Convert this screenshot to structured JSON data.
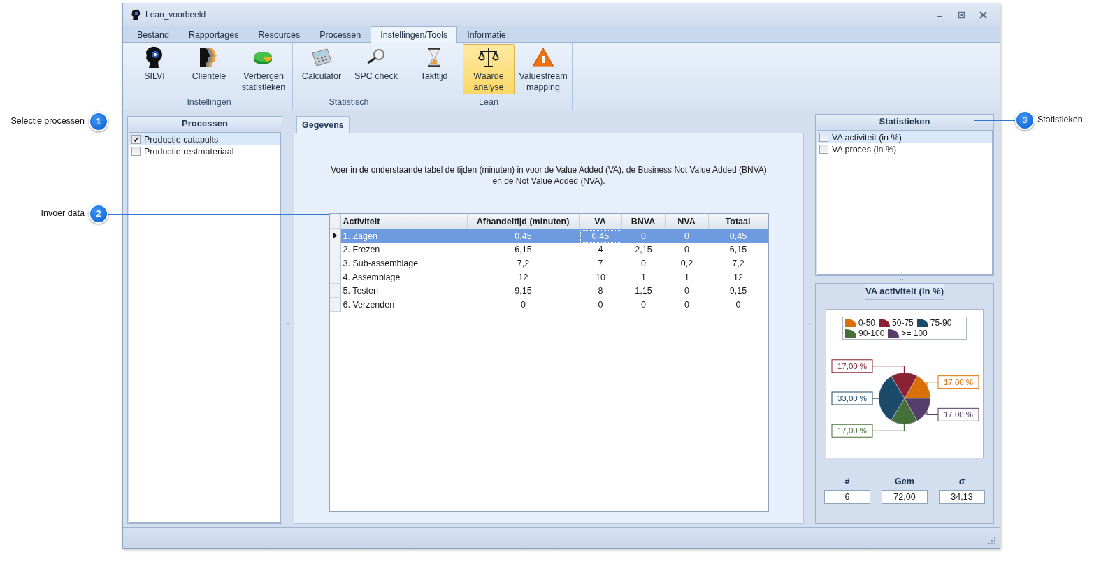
{
  "window": {
    "title": "Lean_voorbeeld"
  },
  "menu_tabs": [
    {
      "label": "Bestand",
      "selected": false
    },
    {
      "label": "Rapportages",
      "selected": false
    },
    {
      "label": "Resources",
      "selected": false
    },
    {
      "label": "Processen",
      "selected": false
    },
    {
      "label": "Instellingen/Tools",
      "selected": true
    },
    {
      "label": "Informatie",
      "selected": false
    }
  ],
  "ribbon_groups": [
    {
      "label": "Instellingen",
      "buttons": [
        {
          "kind": "head",
          "label": "SILVI",
          "selected": false
        },
        {
          "kind": "people",
          "label": "Clientele",
          "selected": false
        },
        {
          "kind": "pie",
          "label": "Verbergen statistieken",
          "selected": false
        }
      ]
    },
    {
      "label": "Statistisch",
      "buttons": [
        {
          "kind": "calculator",
          "label": "Calculator",
          "selected": false
        },
        {
          "kind": "magnifier",
          "label": "SPC check",
          "selected": false
        }
      ]
    },
    {
      "label": "Lean",
      "buttons": [
        {
          "kind": "hourglass",
          "label": "Takttijd",
          "selected": false
        },
        {
          "kind": "scales",
          "label": "Waarde analyse",
          "selected": true
        },
        {
          "kind": "warning",
          "label": "Valuestream mapping",
          "selected": false
        }
      ]
    }
  ],
  "processes_panel": {
    "title": "Processen",
    "items": [
      {
        "label": "Productie catapults",
        "checked": true,
        "selected": true
      },
      {
        "label": "Productie restmateriaal",
        "checked": false,
        "selected": false
      }
    ]
  },
  "data_tab": {
    "label": "Gegevens",
    "selected": true
  },
  "instruction": "Voer in de onderstaande tabel de tijden (minuten) in voor de Value Added (VA), de Business Not Value Added (BNVA) en de Not Value Added (NVA).",
  "table": {
    "columns": [
      "Activiteit",
      "Afhandeltijd (minuten)",
      "VA",
      "BNVA",
      "NVA",
      "Totaal"
    ],
    "rows": [
      {
        "selected": true,
        "focused": [
          false,
          false,
          true,
          false,
          false,
          false
        ],
        "cells": [
          "1. Zagen",
          "0,45",
          "0,45",
          "0",
          "0",
          "0,45"
        ]
      },
      {
        "selected": false,
        "focused": [
          false,
          false,
          false,
          false,
          false,
          false
        ],
        "cells": [
          "2. Frezen",
          "6,15",
          "4",
          "2,15",
          "0",
          "6,15"
        ]
      },
      {
        "selected": false,
        "focused": [
          false,
          false,
          false,
          false,
          false,
          false
        ],
        "cells": [
          "3. Sub-assemblage",
          "7,2",
          "7",
          "0",
          "0,2",
          "7,2"
        ]
      },
      {
        "selected": false,
        "focused": [
          false,
          false,
          false,
          false,
          false,
          false
        ],
        "cells": [
          "4. Assemblage",
          "12",
          "10",
          "1",
          "1",
          "12"
        ]
      },
      {
        "selected": false,
        "focused": [
          false,
          false,
          false,
          false,
          false,
          false
        ],
        "cells": [
          "5. Testen",
          "9,15",
          "8",
          "1,15",
          "0",
          "9,15"
        ]
      },
      {
        "selected": false,
        "focused": [
          false,
          false,
          false,
          false,
          false,
          false
        ],
        "cells": [
          "6. Verzenden",
          "0",
          "0",
          "0",
          "0",
          "0"
        ]
      }
    ]
  },
  "statistics_panel": {
    "title": "Statistieken",
    "items": [
      {
        "label": "VA activiteit (in %)",
        "checked": false,
        "selected": true
      },
      {
        "label": "VA proces (in %)",
        "checked": false,
        "selected": false
      }
    ]
  },
  "chart_panel": {
    "title": "VA activiteit (in %)",
    "chart_data": {
      "type": "pie",
      "categories": [
        "0-50",
        "50-75",
        "75-90",
        "90-100",
        ">= 100"
      ],
      "colors": [
        "#d9700a",
        "#8a2233",
        "#1b4a6b",
        "#45703a",
        "#553d6a"
      ],
      "legend": "top",
      "values": [
        17,
        17,
        33,
        17,
        17
      ],
      "value_labels": [
        "17,00 %",
        "17,00 %",
        "33,00 %",
        "17,00 %",
        "17,00 %"
      ]
    },
    "stats": [
      {
        "label": "#",
        "value": "6"
      },
      {
        "label": "Gem",
        "value": "72,00"
      },
      {
        "label": "σ",
        "value": "34,13"
      }
    ]
  },
  "callouts": [
    {
      "number": "1",
      "label": "Selectie processen"
    },
    {
      "number": "2",
      "label": "Invoer data"
    },
    {
      "number": "3",
      "label": "Statistieken"
    }
  ]
}
